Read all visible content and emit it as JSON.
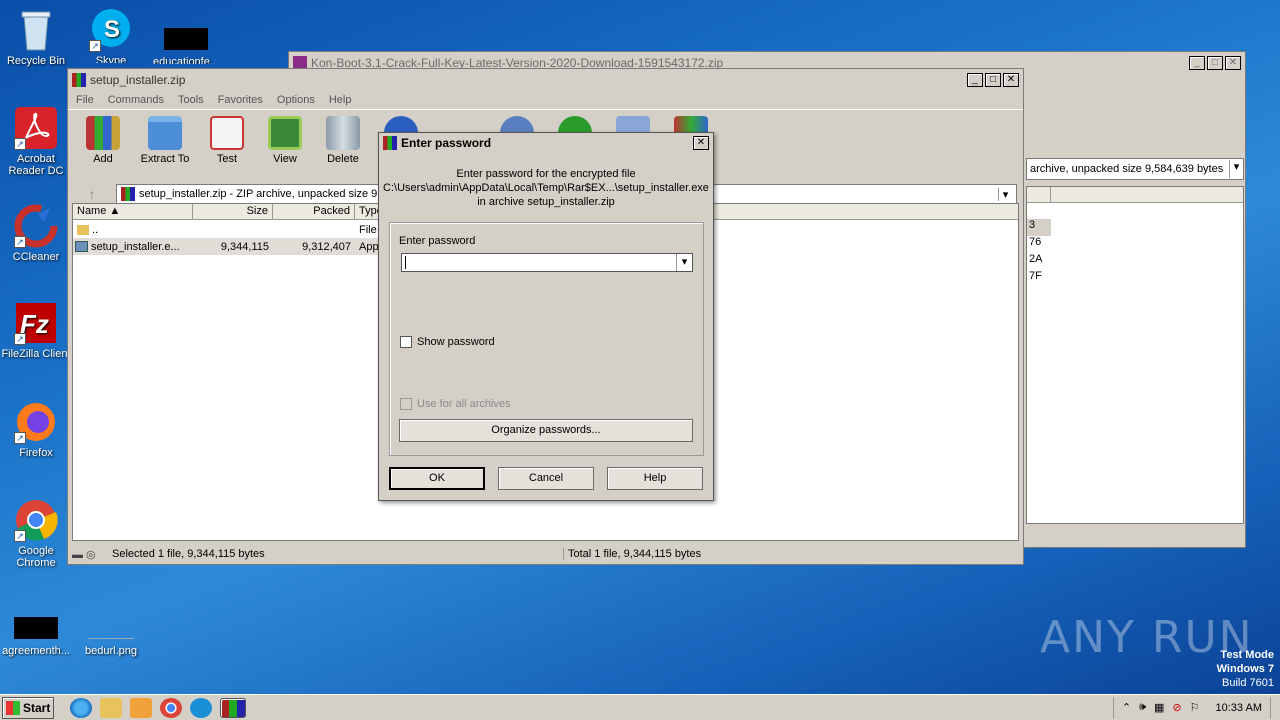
{
  "desktop": {
    "icons": [
      {
        "label": "Recycle Bin"
      },
      {
        "label": "Skype"
      },
      {
        "label": "educationfe..."
      },
      {
        "label": "Acrobat Reader DC"
      },
      {
        "label": "CCleaner"
      },
      {
        "label": "FileZilla Client"
      },
      {
        "label": "Firefox"
      },
      {
        "label": "Google Chrome"
      },
      {
        "label": "agreementh..."
      },
      {
        "label": "bedurl.png"
      }
    ],
    "watermark": "ANY RUN",
    "os_info": {
      "line1": "Test Mode",
      "line2": "Windows 7",
      "line3": "Build 7601"
    }
  },
  "back_window": {
    "title": "Kon-Boot-3.1-Crack-Full-Key-Latest-Version-2020-Download-1591543172.zip",
    "addr_text": "archive, unpacked size 9,584,639 bytes",
    "values": [
      "3",
      "76",
      "2A",
      "7F"
    ]
  },
  "main_window": {
    "title": "setup_installer.zip",
    "menu": [
      "File",
      "Commands",
      "Tools",
      "Favorites",
      "Options",
      "Help"
    ],
    "toolbar": [
      {
        "label": "Add",
        "icon": "add-archive-icon"
      },
      {
        "label": "Extract To",
        "icon": "extract-folder-icon"
      },
      {
        "label": "Test",
        "icon": "test-clipboard-icon"
      },
      {
        "label": "View",
        "icon": "view-book-icon"
      },
      {
        "label": "Delete",
        "icon": "trash-icon"
      }
    ],
    "address": "setup_installer.zip - ZIP archive, unpacked size 9",
    "columns": [
      "Name",
      "Size",
      "Packed",
      "Type"
    ],
    "rows": [
      {
        "name": "..",
        "size": "",
        "packed": "",
        "type": "File f"
      },
      {
        "name": "setup_installer.e...",
        "size": "9,344,115",
        "packed": "9,312,407",
        "type": "Appl"
      }
    ],
    "status_left": "Selected 1 file, 9,344,115 bytes",
    "status_right": "Total 1 file, 9,344,115 bytes"
  },
  "dialog": {
    "title": "Enter password",
    "message_line1": "Enter password for the encrypted file",
    "message_line2": "C:\\Users\\admin\\AppData\\Local\\Temp\\Rar$EX...\\setup_installer.exe",
    "message_line3": "in archive setup_installer.zip",
    "field_label": "Enter password",
    "password_value": "",
    "show_password": "Show password",
    "use_for_all": "Use for all archives",
    "organize": "Organize passwords...",
    "ok": "OK",
    "cancel": "Cancel",
    "help": "Help"
  },
  "taskbar": {
    "start": "Start",
    "clock": "10:33 AM"
  },
  "colors": {
    "desktop_blue": "#1a73c9",
    "window_gray": "#d4d0c8",
    "selection": "#d4d0c8"
  }
}
